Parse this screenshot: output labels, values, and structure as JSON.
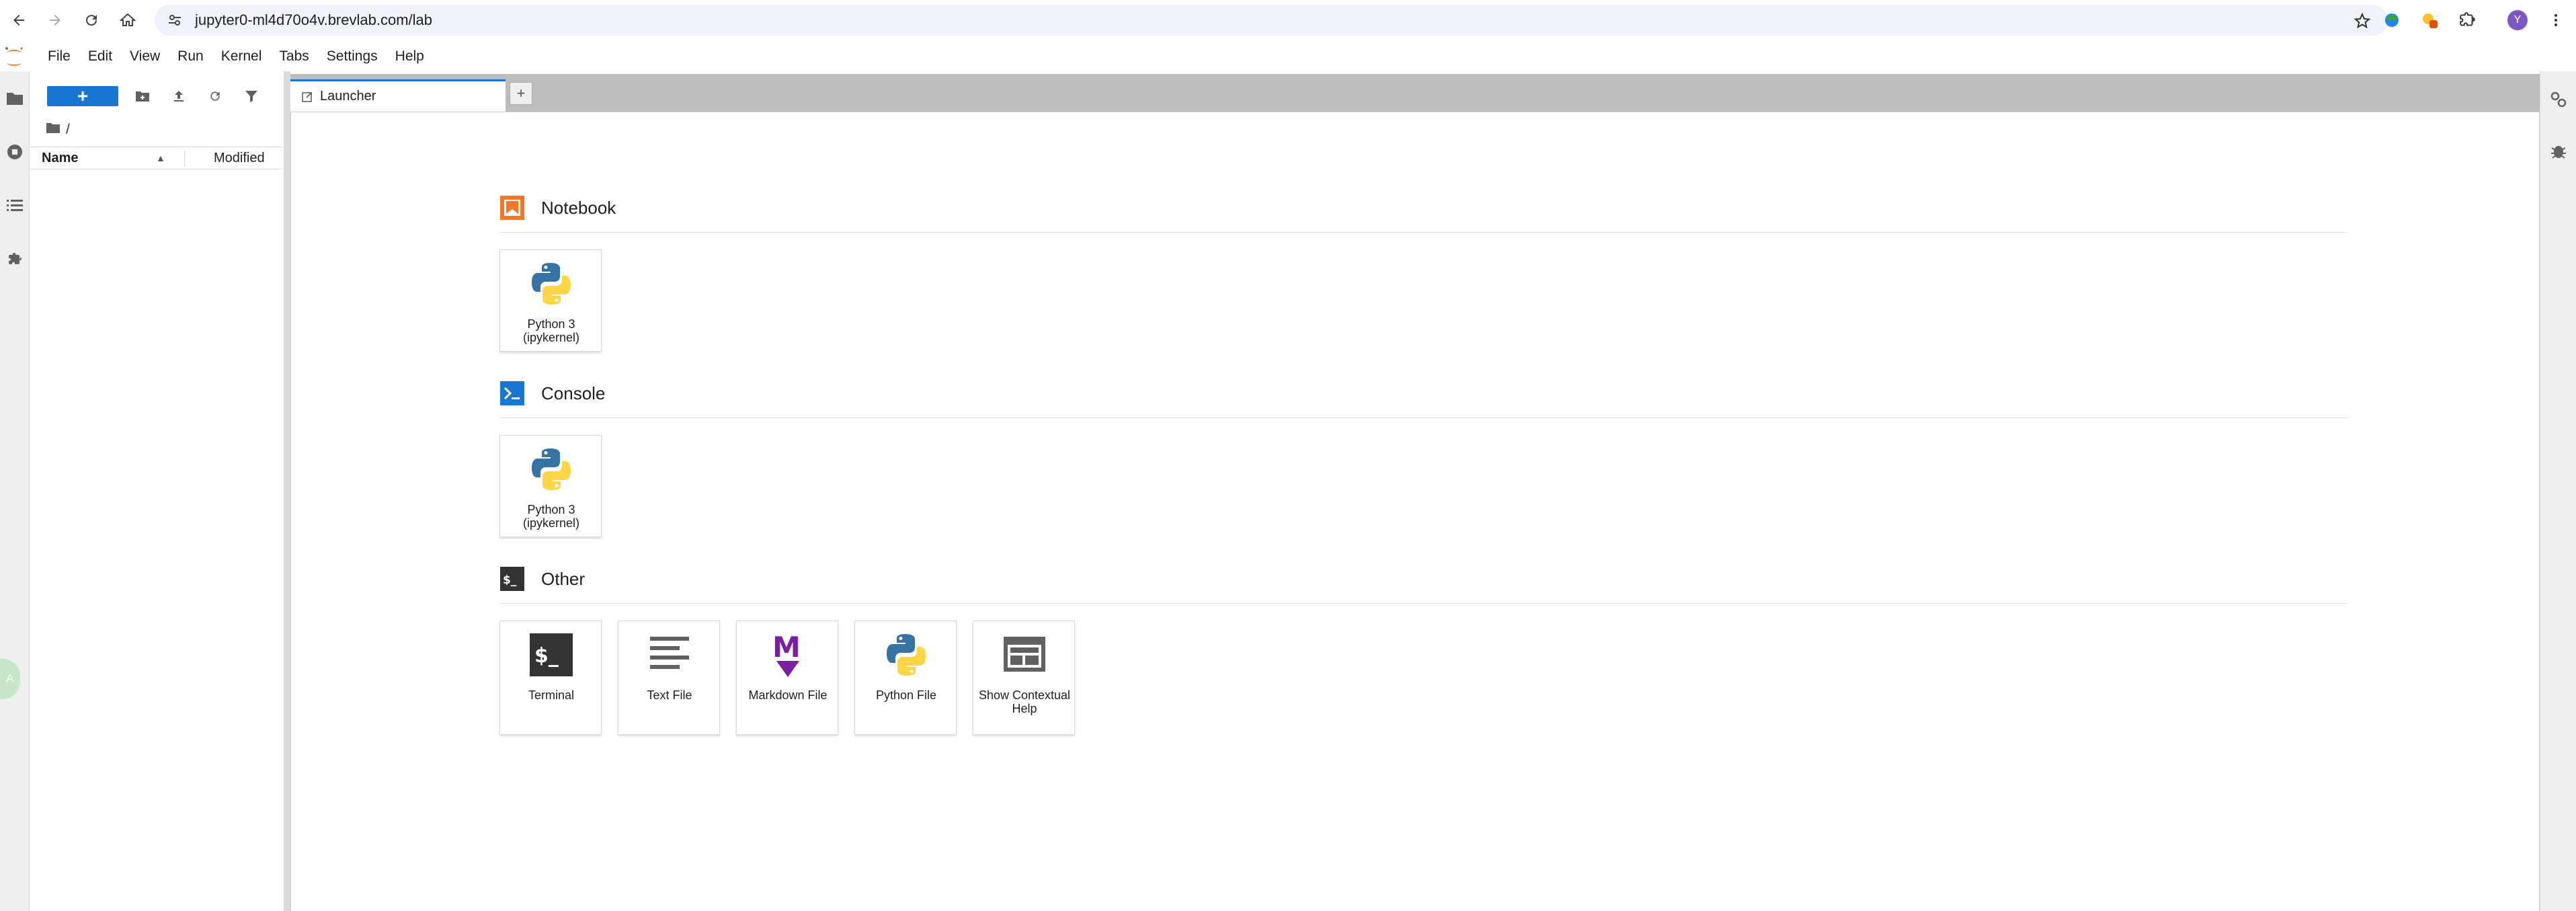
{
  "browser": {
    "url": "jupyter0-ml4d70o4v.brevlab.com/lab",
    "profile_initial": "Y"
  },
  "menubar": {
    "items": [
      "File",
      "Edit",
      "View",
      "Run",
      "Kernel",
      "Tabs",
      "Settings",
      "Help"
    ]
  },
  "file_browser": {
    "new_button_label": "+",
    "breadcrumb": "/",
    "columns": {
      "name": "Name",
      "modified": "Modified"
    }
  },
  "tabs": {
    "active": "Launcher",
    "add_label": "+"
  },
  "launcher": {
    "notebook": {
      "title": "Notebook",
      "cards": [
        "Python 3 (ipykernel)"
      ]
    },
    "console": {
      "title": "Console",
      "cards": [
        "Python 3 (ipykernel)"
      ]
    },
    "other": {
      "title": "Other",
      "cards": [
        "Terminal",
        "Text File",
        "Markdown File",
        "Python File",
        "Show Contextual Help"
      ]
    }
  },
  "colors": {
    "accent": "#1976d2",
    "notebook_icon": "#f37726",
    "console_icon": "#1976d2",
    "terminal_icon": "#333333",
    "markdown_icon": "#7b1fa2"
  }
}
